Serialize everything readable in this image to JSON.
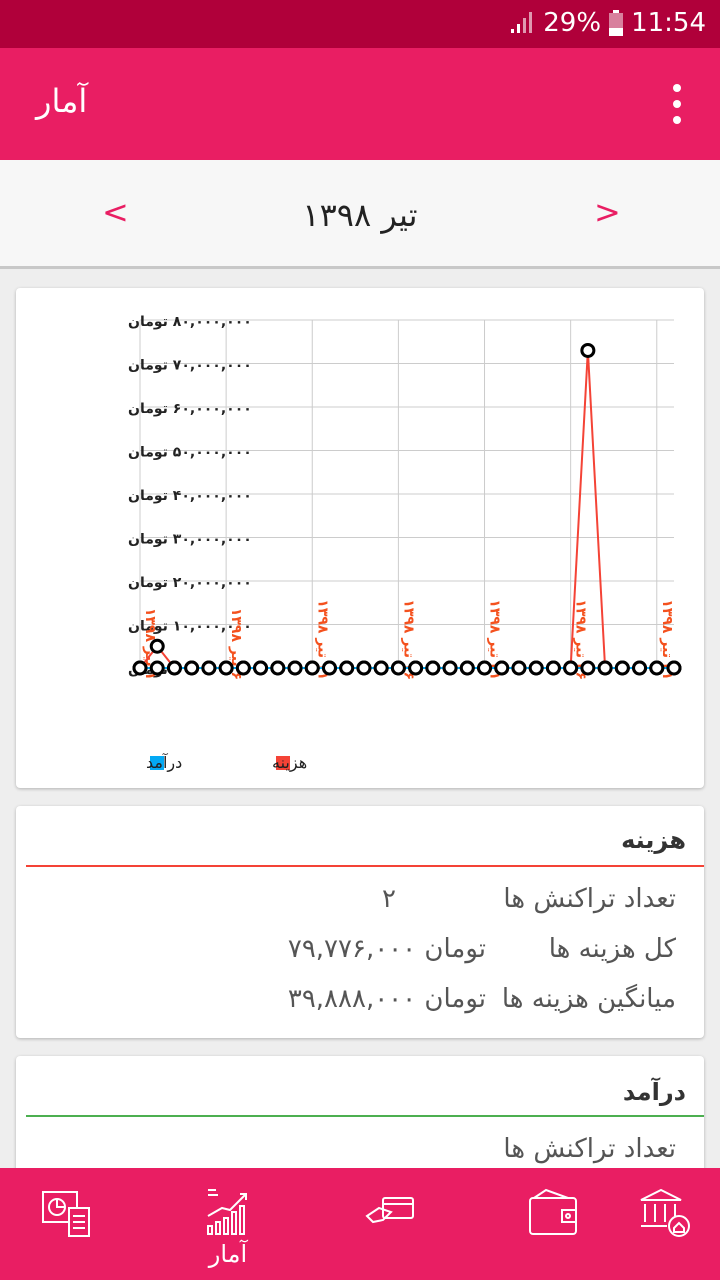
{
  "status": {
    "battery": "29%",
    "time": "11:54"
  },
  "appbar": {
    "title": "آمار"
  },
  "month": {
    "label": "تیر ۱۳۹۸",
    "prev": "<",
    "next": ">"
  },
  "chart_data": {
    "type": "line",
    "y_ticks": [
      "۰ تومان",
      "۱۰,۰۰۰,۰۰۰ تومان",
      "۲۰,۰۰۰,۰۰۰ تومان",
      "۳۰,۰۰۰,۰۰۰ تومان",
      "۴۰,۰۰۰,۰۰۰ تومان",
      "۵۰,۰۰۰,۰۰۰ تومان",
      "۶۰,۰۰۰,۰۰۰ تومان",
      "۷۰,۰۰۰,۰۰۰ تومان",
      "۸۰,۰۰۰,۰۰۰ تومان"
    ],
    "ylim": [
      0,
      80000000
    ],
    "x_ticks": [
      "۱ تیر ۱۳۹۸",
      "۶ تیر ۱۳۹۸",
      "۱۱ تیر ۱۳۹۸",
      "۱۶ تیر ۱۳۹۸",
      "۲۱ تیر ۱۳۹۸",
      "۲۶ تیر ۱۳۹۸",
      "۳۱ تیر ۱۳۹۸"
    ],
    "x": [
      1,
      2,
      3,
      4,
      5,
      6,
      7,
      8,
      9,
      10,
      11,
      12,
      13,
      14,
      15,
      16,
      17,
      18,
      19,
      20,
      21,
      22,
      23,
      24,
      25,
      26,
      27,
      28,
      29,
      30,
      31
    ],
    "series": [
      {
        "name": "هزینه",
        "color": "#f44336",
        "values": [
          0,
          5000000,
          0,
          0,
          0,
          0,
          0,
          0,
          0,
          0,
          0,
          0,
          0,
          0,
          0,
          0,
          0,
          0,
          0,
          0,
          0,
          0,
          0,
          0,
          0,
          0,
          73000000,
          0,
          0,
          0,
          0,
          0
        ]
      },
      {
        "name": "درآمد",
        "color": "#03a9f4",
        "values": [
          0,
          0,
          0,
          0,
          0,
          0,
          0,
          0,
          0,
          0,
          0,
          0,
          0,
          0,
          0,
          0,
          0,
          0,
          0,
          0,
          0,
          0,
          0,
          0,
          0,
          0,
          0,
          0,
          0,
          0,
          0,
          0
        ]
      }
    ],
    "grid": true,
    "legend": "bottom-left"
  },
  "expense": {
    "title": "هزینه",
    "color": "#f44336",
    "rows": [
      {
        "label": "تعداد تراکنش ها",
        "value": "۲"
      },
      {
        "label": "کل هزینه ها",
        "value": "۷۹,۷۷۶,۰۰۰ تومان"
      },
      {
        "label": "میانگین هزینه ها",
        "value": "۳۹,۸۸۸,۰۰۰ تومان"
      }
    ]
  },
  "income": {
    "title": "درآمد",
    "color": "#4caf50",
    "rows": [
      {
        "label": "تعداد تراکنش ها",
        "value": ""
      }
    ]
  },
  "nav": {
    "stats_label": "آمار"
  },
  "icons": [
    "calculator-icon",
    "stats-chart-icon",
    "card-payment-icon",
    "wallet-icon",
    "bank-icon",
    "menu-dots-icon",
    "signal-icon",
    "battery-icon"
  ]
}
